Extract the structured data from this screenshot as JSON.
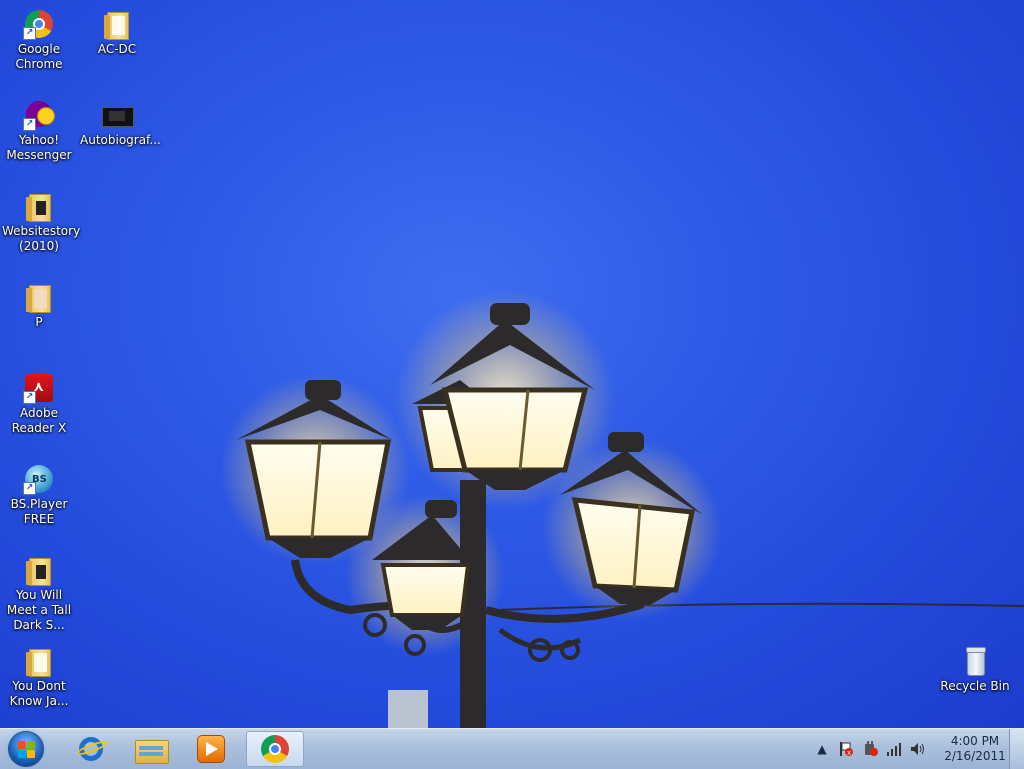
{
  "desktop": {
    "icons": [
      {
        "label": "Google Chrome",
        "icon": "chrome-icon"
      },
      {
        "label": "AC-DC",
        "icon": "folder-icon"
      },
      {
        "label": "Yahoo! Messenger",
        "icon": "yahoo-messenger-icon"
      },
      {
        "label": "Autobiograf...",
        "icon": "video-file-icon"
      },
      {
        "label": "Websitestory (2010)",
        "icon": "folder-icon"
      },
      {
        "label": "P",
        "icon": "folder-icon"
      },
      {
        "label": "Adobe Reader X",
        "icon": "adobe-reader-icon"
      },
      {
        "label": "BS.Player FREE",
        "icon": "bsplayer-icon"
      },
      {
        "label": "You Will Meet a Tall Dark S...",
        "icon": "folder-icon"
      },
      {
        "label": "You Dont Know Ja...",
        "icon": "folder-icon"
      },
      {
        "label": "Recycle Bin",
        "icon": "recycle-bin-icon"
      }
    ]
  },
  "taskbar": {
    "pinned": [
      "internet-explorer-icon",
      "windows-explorer-icon",
      "media-player-icon",
      "chrome-icon"
    ],
    "tray": {
      "time": "4:00 PM",
      "date": "2/16/2011"
    }
  }
}
